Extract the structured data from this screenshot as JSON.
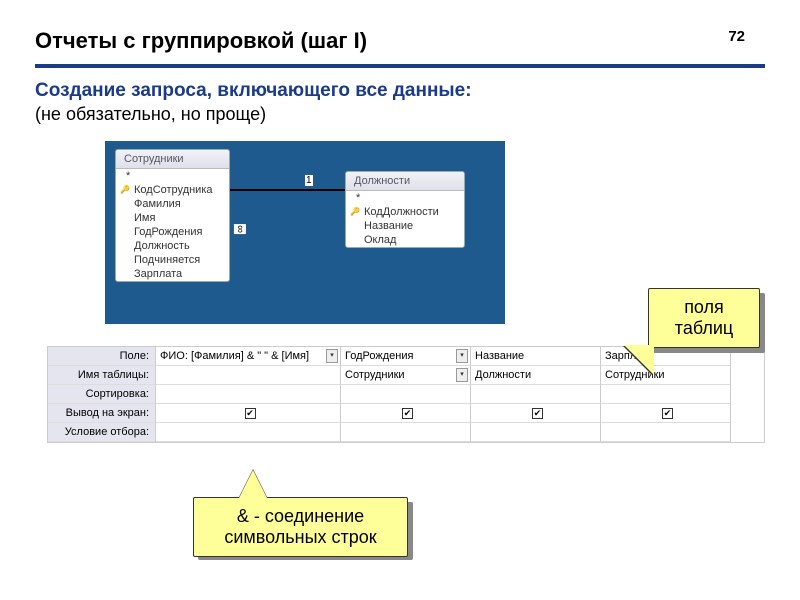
{
  "header": {
    "title": "Отчеты с группировкой (шаг I)",
    "page": "72"
  },
  "subtitle": "Создание запроса, включающего все данные:",
  "note": "(не обязательно, но проще)",
  "tables": {
    "t1": {
      "name": "Сотрудники",
      "fields": [
        "*",
        "КодСотрудника",
        "Фамилия",
        "Имя",
        "ГодРождения",
        "Должность",
        "Подчиняется",
        "Зарплата"
      ]
    },
    "t2": {
      "name": "Должности",
      "fields": [
        "*",
        "КодДолжности",
        "Название",
        "Оклад"
      ]
    },
    "relation": {
      "one": "1",
      "many": "∞"
    }
  },
  "grid": {
    "labels": {
      "field": "Поле:",
      "table": "Имя таблицы:",
      "sort": "Сортировка:",
      "show": "Вывод на экран:",
      "crit": "Условие отбора:"
    },
    "cols": [
      {
        "field": "ФИО: [Фамилия] & \" \" & [Имя]",
        "table": "",
        "show": true
      },
      {
        "field": "ГодРождения",
        "table": "Сотрудники",
        "show": true
      },
      {
        "field": "Название",
        "table": "Должности",
        "show": true
      },
      {
        "field": "Зарплата",
        "table": "Сотрудники",
        "show": true
      }
    ]
  },
  "callouts": {
    "c1": {
      "line1": "поля",
      "line2": "таблиц"
    },
    "c2": {
      "line1": "& - соединение",
      "line2": "символьных строк"
    }
  }
}
